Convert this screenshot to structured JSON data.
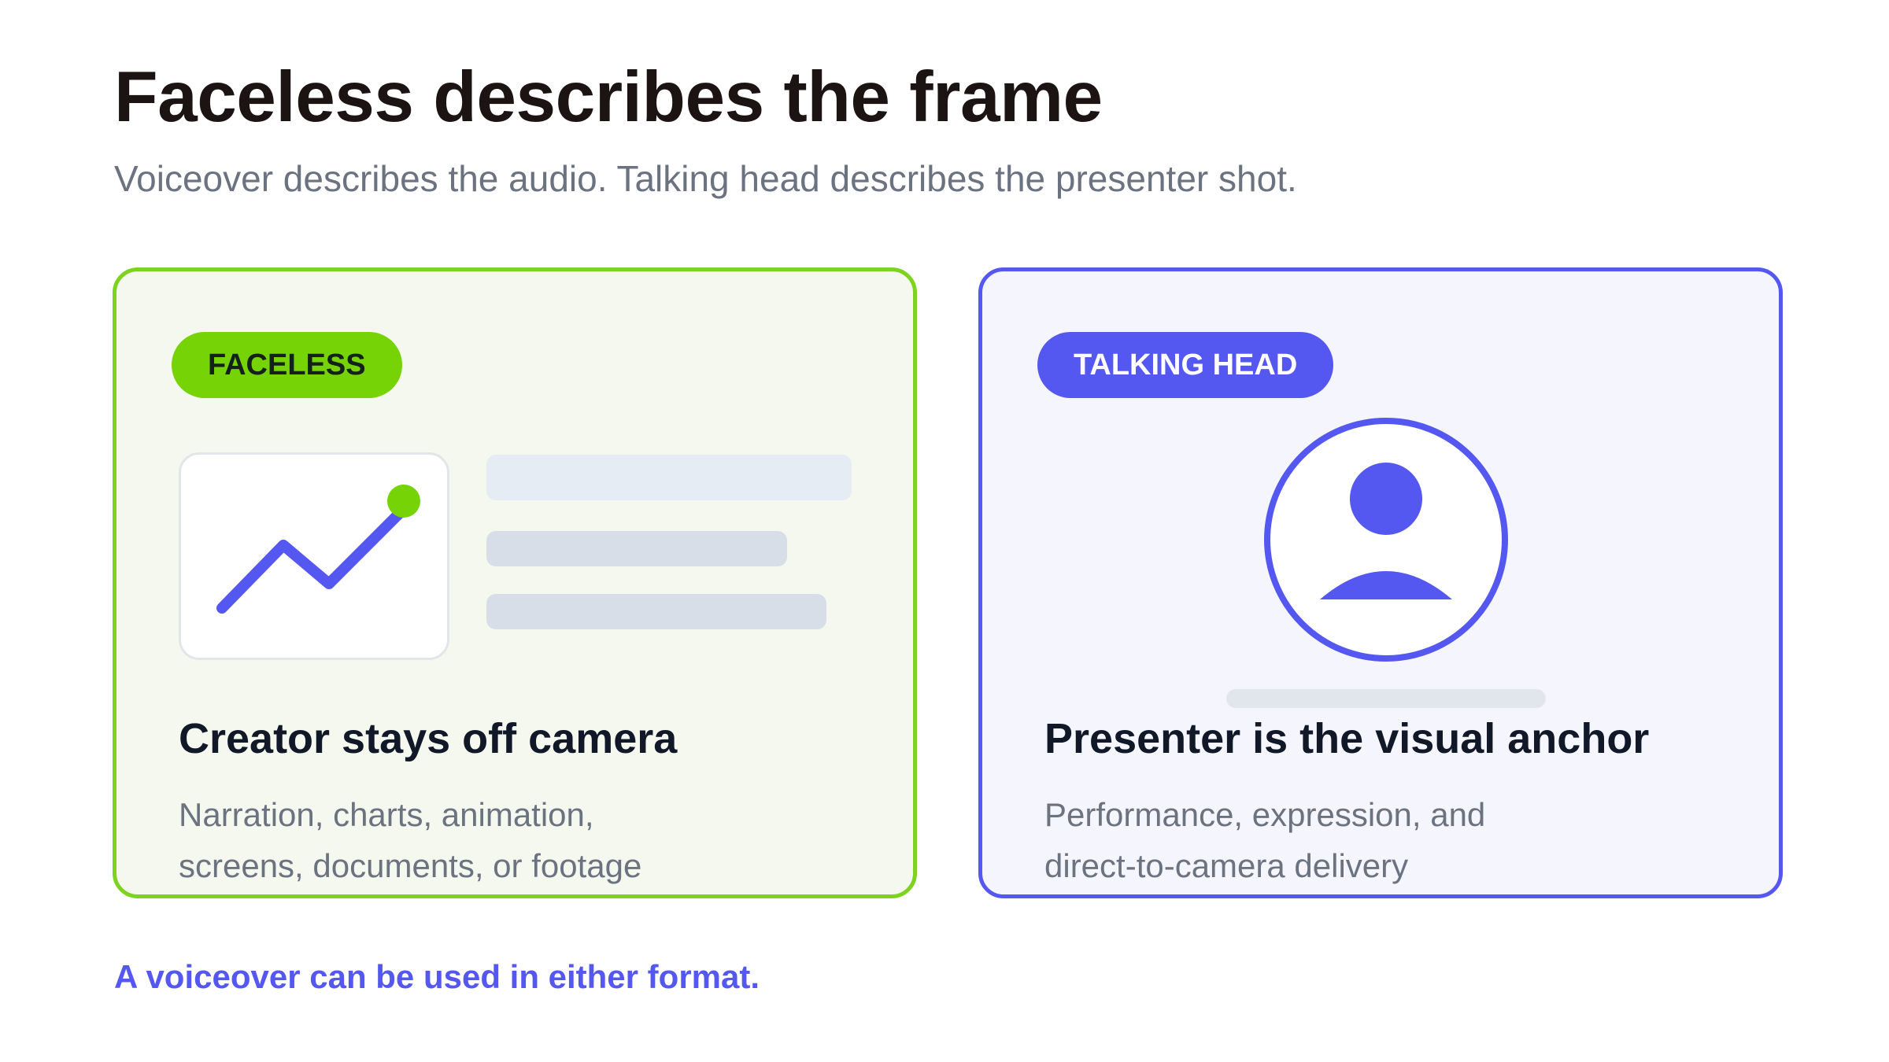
{
  "title": "Faceless describes the frame",
  "subtitle": "Voiceover describes the audio. Talking head describes the presenter shot.",
  "colors": {
    "green": "#76d305",
    "green_border": "#7ed321",
    "blue": "#5558f0",
    "heading": "#1c1412",
    "muted": "#6b7280"
  },
  "cards": [
    {
      "badge": "FACELESS",
      "illustration": "line-chart-icon",
      "heading": "Creator stays off camera",
      "description_lines": [
        "Narration, charts, animation,",
        "screens, documents, or footage"
      ]
    },
    {
      "badge": "TALKING HEAD",
      "illustration": "person-avatar-icon",
      "heading": "Presenter is the visual anchor",
      "description_lines": [
        "Performance, expression, and",
        "direct-to-camera delivery"
      ]
    }
  ],
  "footnote": "A voiceover can be used in either format."
}
